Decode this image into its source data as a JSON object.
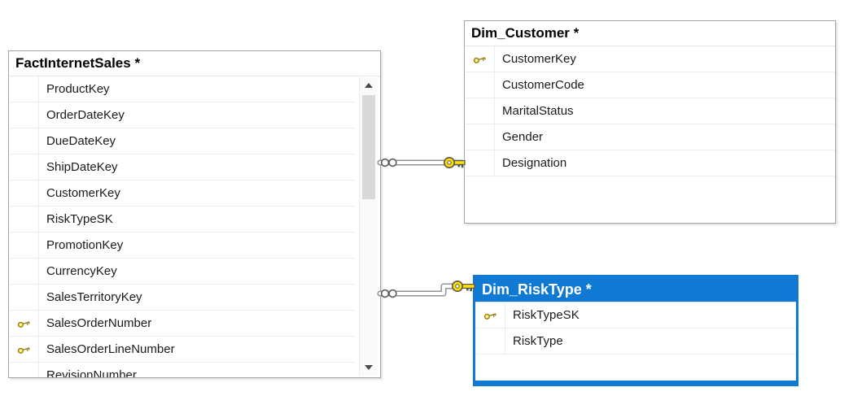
{
  "diagram": {
    "type": "database-diagram",
    "background": "#ffffff"
  },
  "colors": {
    "selected_accent": "#1079d4",
    "table_border": "#a0a4ab",
    "row_divider": "#e9edf5",
    "header_divider": "#e2e6ee",
    "key_icon_yellow": "#ffe14d",
    "connector_outline": "#8f9296",
    "connector_key_yellow": "#ffe100",
    "title_text": "#000000",
    "column_text": "#1a1a1a",
    "selected_title_text": "#ffffff"
  },
  "tables": [
    {
      "id": "FactInternetSales",
      "title": "FactInternetSales *",
      "selected": false,
      "has_vertical_scrollbar": true,
      "columns": [
        {
          "name": "ProductKey",
          "key": false
        },
        {
          "name": "OrderDateKey",
          "key": false
        },
        {
          "name": "DueDateKey",
          "key": false
        },
        {
          "name": "ShipDateKey",
          "key": false
        },
        {
          "name": "CustomerKey",
          "key": false
        },
        {
          "name": "RiskTypeSK",
          "key": false
        },
        {
          "name": "PromotionKey",
          "key": false
        },
        {
          "name": "CurrencyKey",
          "key": false
        },
        {
          "name": "SalesTerritoryKey",
          "key": false
        },
        {
          "name": "SalesOrderNumber",
          "key": true
        },
        {
          "name": "SalesOrderLineNumber",
          "key": true
        },
        {
          "name": "RevisionNumber",
          "key": false
        }
      ]
    },
    {
      "id": "Dim_Customer",
      "title": "Dim_Customer *",
      "selected": false,
      "has_vertical_scrollbar": false,
      "columns": [
        {
          "name": "CustomerKey",
          "key": true
        },
        {
          "name": "CustomerCode",
          "key": false
        },
        {
          "name": "MaritalStatus",
          "key": false
        },
        {
          "name": "Gender",
          "key": false
        },
        {
          "name": "Designation",
          "key": false
        }
      ]
    },
    {
      "id": "Dim_RiskType",
      "title": "Dim_RiskType *",
      "selected": true,
      "has_vertical_scrollbar": false,
      "columns": [
        {
          "name": "RiskTypeSK",
          "key": true
        },
        {
          "name": "RiskType",
          "key": false
        }
      ]
    }
  ],
  "relationships": [
    {
      "from_table": "FactInternetSales",
      "to_table": "Dim_Customer",
      "cardinality": "many-to-one",
      "many_end_icon": "infinity-circles",
      "one_end_icon": "key"
    },
    {
      "from_table": "FactInternetSales",
      "to_table": "Dim_RiskType",
      "cardinality": "many-to-one",
      "many_end_icon": "infinity-circles",
      "one_end_icon": "key"
    }
  ]
}
